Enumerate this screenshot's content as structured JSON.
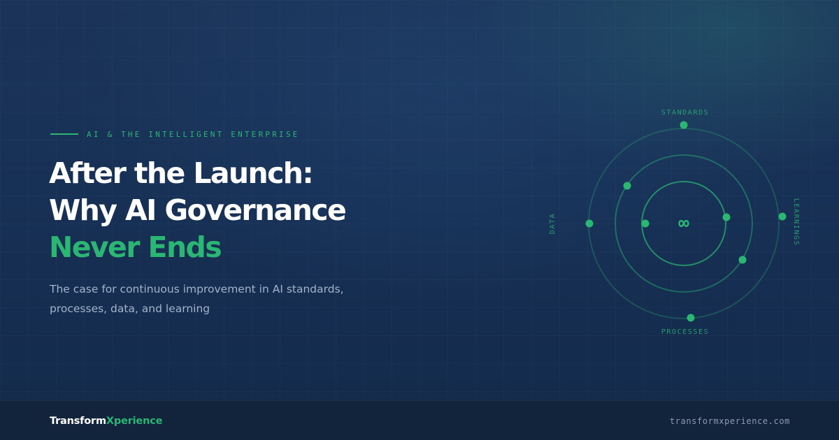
{
  "eyebrow": "AI & THE INTELLIGENT ENTERPRISE",
  "headline": {
    "line1": "After the Launch:",
    "line2": "Why AI Governance",
    "line3": "Never Ends"
  },
  "subtitle": "The case for continuous improvement in AI standards, processes, data, and learning",
  "diagram": {
    "center_symbol": "∞",
    "label_top": "STANDARDS",
    "label_left": "DATA",
    "label_right": "LEARNINGS",
    "label_bottom": "PROCESSES"
  },
  "footer": {
    "brand_part1": "Transform",
    "brand_part2": "Xperience",
    "website": "transformxperience.com"
  },
  "colors": {
    "background": "#173055",
    "accent": "#2bb673",
    "headline": "#ffffff",
    "subtitle": "#a3b3c9",
    "footer": "#12233c"
  }
}
